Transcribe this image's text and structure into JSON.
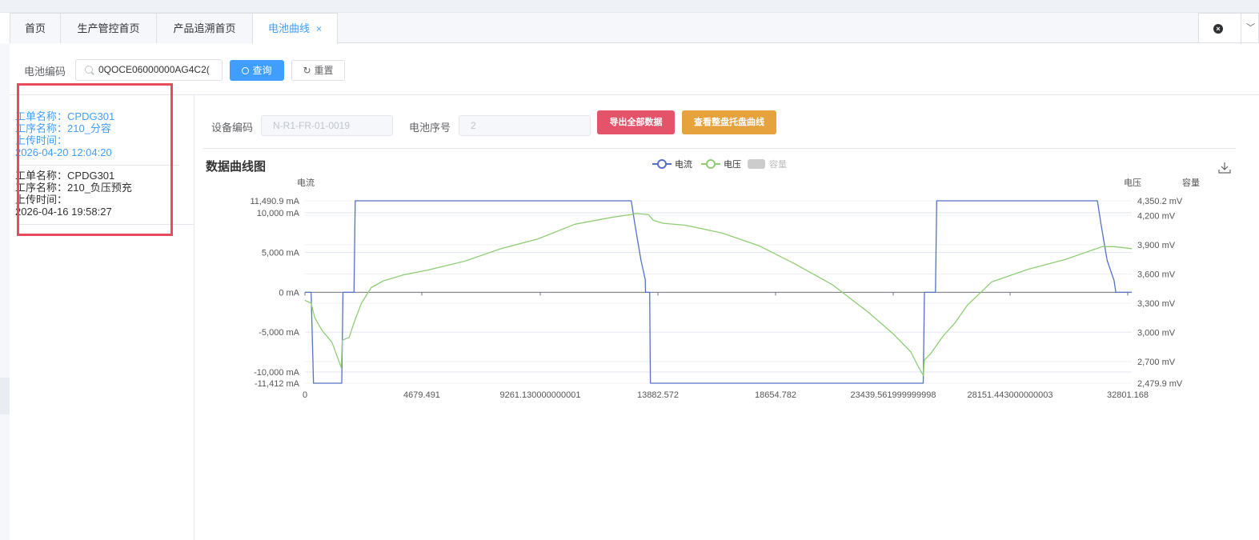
{
  "tabs": [
    {
      "label": "首页",
      "active": false
    },
    {
      "label": "生产管控首页",
      "active": false
    },
    {
      "label": "产品追溯首页",
      "active": false
    },
    {
      "label": "电池曲线",
      "active": true,
      "close": "×"
    }
  ],
  "search": {
    "label": "电池编码",
    "value": "0QOCE06000000AG4C2(",
    "query_label": "查询",
    "reset_label": "重置"
  },
  "records": [
    {
      "order_label": "工单名称：",
      "order": "CPDG301",
      "process_label": "工序名称：",
      "process": "210_分容",
      "time_label": "上传时间：",
      "time": "2026-04-20 12:04:20",
      "active": true
    },
    {
      "order_label": "工单名称：",
      "order": "CPDG301",
      "process_label": "工序名称：",
      "process": "210_负压预充",
      "time_label": "上传时间：",
      "time": "2026-04-16 19:58:27",
      "active": false
    }
  ],
  "device": {
    "code_label": "设备编码",
    "code_value": "N-R1-FR-01-0019",
    "seq_label": "电池序号",
    "seq_value": "2",
    "export_label": "导出全部数据",
    "tray_label": "查看整盘托盘曲线"
  },
  "colors": {
    "primary": "#409eff",
    "current_line": "#5470c6",
    "voltage_line": "#91cc75",
    "capacity_legend": "#cccccc",
    "export_btn": "#e5536b",
    "tray_btn": "#e6a23c",
    "highlight_box": "#e74c5c"
  },
  "chart_data": {
    "type": "line",
    "title": "数据曲线图",
    "legend": [
      "电流",
      "电压",
      "容量"
    ],
    "legend_disabled": [
      "容量"
    ],
    "legend_position": "top-center",
    "y_left_name": "电流",
    "y_right_names": [
      "电压",
      "容量"
    ],
    "x_ticks": [
      "0",
      "4679.491",
      "9261.130000000001",
      "13882.572",
      "18654.782",
      "23439.561999999998",
      "28151.443000000003",
      "32801.168"
    ],
    "x_range": [
      0,
      33700
    ],
    "y_left_ticks": [
      "11,490.9 mA",
      "10,000 mA",
      "5,000 mA",
      "0 mA",
      "-5,000 mA",
      "-10,000 mA",
      "-11,412 mA"
    ],
    "y_left_tick_values": [
      11490.9,
      10000,
      5000,
      0,
      -5000,
      -10000,
      -11412
    ],
    "y_left_range": [
      -11412,
      11490.9
    ],
    "y_right_ticks": [
      "4,350.2 mV",
      "4,200 mV",
      "3,900 mV",
      "3,600 mV",
      "3,300 mV",
      "3,000 mV",
      "2,700 mV",
      "2,479.9 mV"
    ],
    "y_right_tick_values": [
      4350.2,
      4200,
      3900,
      3600,
      3300,
      3000,
      2700,
      2479.9
    ],
    "y_right_range": [
      2479.9,
      4350.2
    ],
    "grid": true,
    "series": [
      {
        "name": "电流",
        "axis": "left",
        "x": [
          0,
          250,
          350,
          1500,
          1550,
          2000,
          2050,
          13300,
          13450,
          13700,
          13870,
          13880,
          14050,
          14080,
          25200,
          25250,
          25700,
          25750,
          32300,
          32450,
          32700,
          32980,
          33050,
          33700
        ],
        "y": [
          0,
          0,
          -11412,
          -11412,
          0,
          0,
          11490.9,
          11490.9,
          8500,
          4000,
          1600,
          0,
          0,
          -11412,
          -11412,
          0,
          0,
          11490.9,
          11490.9,
          8500,
          4000,
          1500,
          0,
          0
        ]
      },
      {
        "name": "电压",
        "axis": "right",
        "x": [
          0,
          250,
          400,
          700,
          1100,
          1480,
          1520,
          1800,
          2000,
          2300,
          2700,
          3200,
          4000,
          5000,
          6500,
          8000,
          9500,
          11000,
          12500,
          13300,
          13500,
          14000,
          14200,
          14600,
          15500,
          17000,
          18500,
          20000,
          21500,
          23000,
          24000,
          24700,
          25000,
          25200,
          25250,
          25500,
          26000,
          26500,
          27000,
          28000,
          29500,
          31000,
          32500,
          33000,
          33700
        ],
        "y": [
          3330,
          3300,
          3150,
          3020,
          2900,
          2640,
          2920,
          2950,
          3100,
          3300,
          3460,
          3530,
          3590,
          3640,
          3730,
          3860,
          3960,
          4110,
          4180,
          4210,
          4220,
          4210,
          4150,
          4120,
          4100,
          4020,
          3890,
          3700,
          3490,
          3200,
          2980,
          2800,
          2650,
          2560,
          2720,
          2780,
          2960,
          3100,
          3280,
          3520,
          3650,
          3750,
          3880,
          3880,
          3860
        ]
      }
    ]
  }
}
